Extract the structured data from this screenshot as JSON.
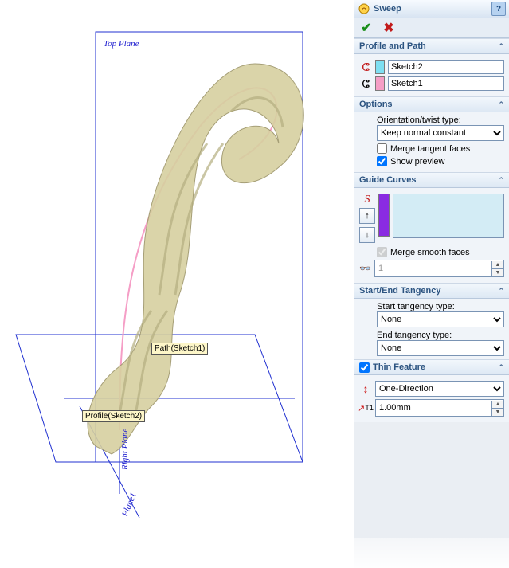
{
  "panel": {
    "title": "Sweep",
    "help": "?",
    "sections": {
      "profile": {
        "title": "Profile and Path",
        "profile_value": "Sketch2",
        "path_value": "Sketch1"
      },
      "options": {
        "title": "Options",
        "orientation_label": "Orientation/twist type:",
        "orientation_options": [
          "Keep normal constant"
        ],
        "merge_tangent_label": "Merge tangent faces",
        "merge_tangent_checked": false,
        "show_preview_label": "Show preview",
        "show_preview_checked": true
      },
      "guide": {
        "title": "Guide Curves",
        "merge_smooth_label": "Merge smooth faces",
        "merge_smooth_checked": true,
        "count_value": "1"
      },
      "tangency": {
        "title": "Start/End Tangency",
        "start_label": "Start tangency type:",
        "start_options": [
          "None"
        ],
        "end_label": "End tangency type:",
        "end_options": [
          "None"
        ]
      },
      "thin": {
        "title": "Thin Feature",
        "enabled": true,
        "type_options": [
          "One-Direction"
        ],
        "thickness_value": "1.00mm"
      }
    }
  },
  "viewport": {
    "top_plane": "Top Plane",
    "right_plane": "Right Plane",
    "plane1": "Plane1",
    "path_tag": "Path(Sketch1)",
    "profile_tag": "Profile(Sketch2)"
  }
}
